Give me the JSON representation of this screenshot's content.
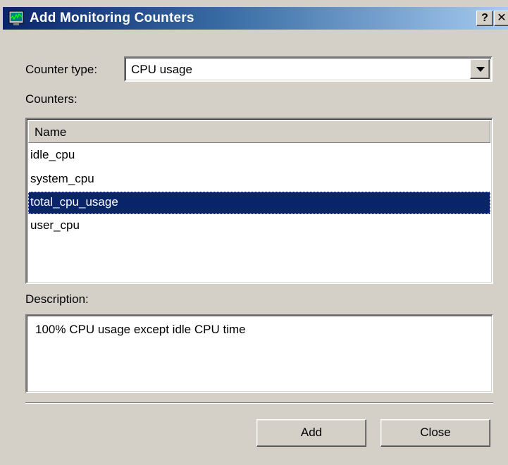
{
  "window": {
    "title": "Add Monitoring Counters",
    "help_label": "?",
    "close_label": "✕"
  },
  "counter_type": {
    "label": "Counter type:",
    "selected": "CPU usage"
  },
  "counters": {
    "label": "Counters:",
    "column_header": "Name",
    "items": [
      "idle_cpu",
      "system_cpu",
      "total_cpu_usage",
      "user_cpu"
    ],
    "selected": "total_cpu_usage"
  },
  "description": {
    "label": "Description:",
    "text": "100% CPU usage except idle CPU time"
  },
  "buttons": {
    "add": "Add",
    "close": "Close"
  },
  "colors": {
    "titlebar_start": "#0a246a",
    "titlebar_end": "#a6caf0",
    "selection": "#0a246a",
    "dialog_bg": "#d4d0c8"
  }
}
